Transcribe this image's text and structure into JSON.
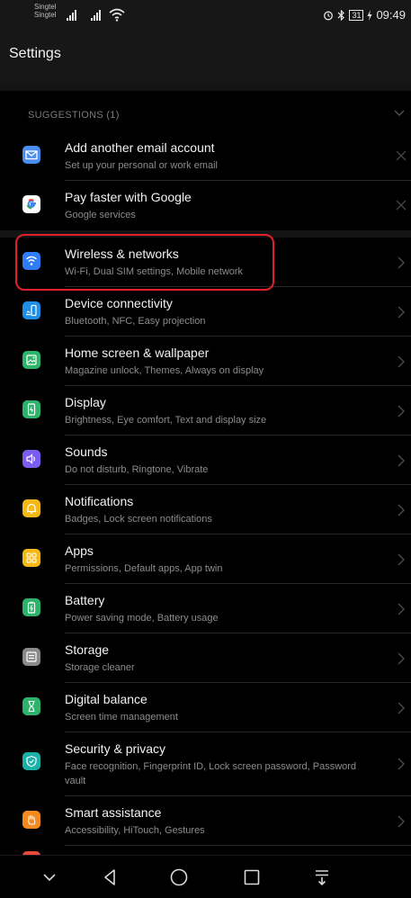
{
  "status_bar": {
    "carrier_1": "Singtel",
    "carrier_2": "Singtel",
    "battery": "31",
    "time": "09:49",
    "icons": [
      "signal-icon",
      "signal-icon",
      "wifi-icon",
      "alarm-icon",
      "bluetooth-icon",
      "battery-icon",
      "charging-icon"
    ]
  },
  "header": {
    "title": "Settings"
  },
  "suggestions": {
    "label": "SUGGESTIONS (1)",
    "items": [
      {
        "title": "Add another email account",
        "subtitle": "Set up your personal or work email",
        "icon": "email-icon",
        "color": "#4a8ff0"
      },
      {
        "title": "Pay faster with Google",
        "subtitle": "Google services",
        "icon": "google-icon",
        "color": "#ffffff"
      }
    ]
  },
  "settings": {
    "items": [
      {
        "title": "Wireless & networks",
        "subtitle": "Wi-Fi, Dual SIM settings, Mobile network",
        "icon": "wifi-icon",
        "color": "#2f7cf6"
      },
      {
        "title": "Device connectivity",
        "subtitle": "Bluetooth, NFC, Easy projection",
        "icon": "device-connectivity-icon",
        "color": "#1e8ee6"
      },
      {
        "title": "Home screen & wallpaper",
        "subtitle": "Magazine unlock, Themes, Always on display",
        "icon": "wallpaper-icon",
        "color": "#2db36a"
      },
      {
        "title": "Display",
        "subtitle": "Brightness, Eye comfort, Text and display size",
        "icon": "display-icon",
        "color": "#2db36a"
      },
      {
        "title": "Sounds",
        "subtitle": "Do not disturb, Ringtone, Vibrate",
        "icon": "sound-icon",
        "color": "#7a5cf0"
      },
      {
        "title": "Notifications",
        "subtitle": "Badges, Lock screen notifications",
        "icon": "notification-icon",
        "color": "#f5b915"
      },
      {
        "title": "Apps",
        "subtitle": "Permissions, Default apps, App twin",
        "icon": "apps-icon",
        "color": "#f5b915"
      },
      {
        "title": "Battery",
        "subtitle": "Power saving mode, Battery usage",
        "icon": "battery-icon",
        "color": "#2db36a"
      },
      {
        "title": "Storage",
        "subtitle": "Storage cleaner",
        "icon": "storage-icon",
        "color": "#8a8a8a"
      },
      {
        "title": "Digital balance",
        "subtitle": "Screen time management",
        "icon": "hourglass-icon",
        "color": "#2db36a"
      },
      {
        "title": "Security & privacy",
        "subtitle": "Face recognition, Fingerprint ID, Lock screen password, Password vault",
        "icon": "security-icon",
        "color": "#1bb0a8"
      },
      {
        "title": "Smart assistance",
        "subtitle": "Accessibility, HiTouch, Gestures",
        "icon": "hand-icon",
        "color": "#f58a1f"
      }
    ]
  },
  "nav_bar": {
    "buttons": [
      "collapse-chevron-icon",
      "back-icon",
      "home-icon",
      "recents-icon",
      "notification-pulldown-icon"
    ]
  }
}
